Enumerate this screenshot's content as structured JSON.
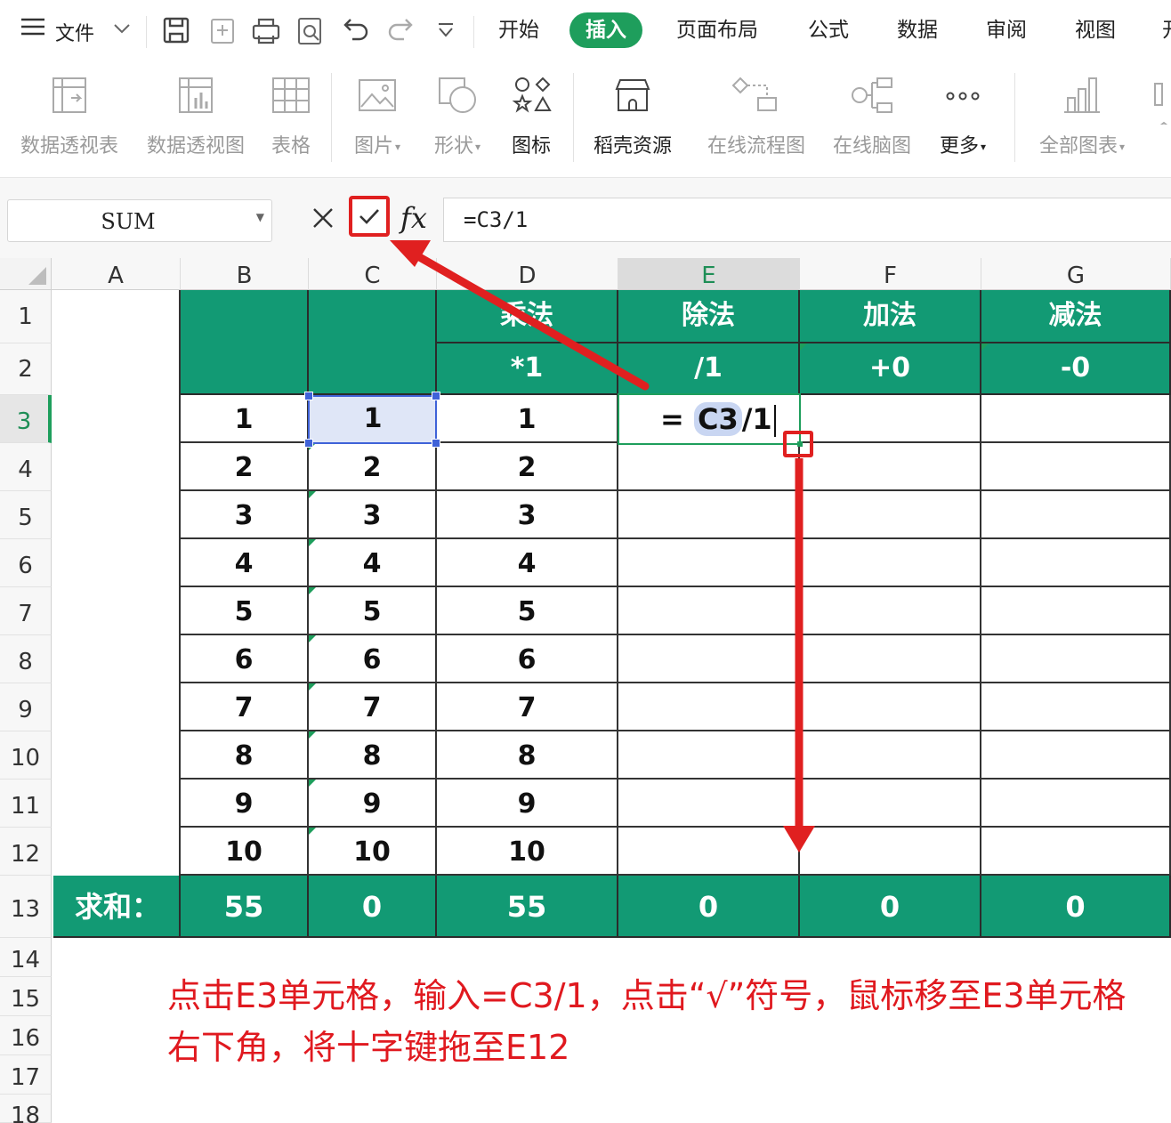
{
  "menu": {
    "file_label": "文件",
    "tabs": [
      "开始",
      "插入",
      "页面布局",
      "公式",
      "数据",
      "审阅",
      "视图"
    ],
    "active_tab": "插入",
    "cutoff_tab": "开"
  },
  "ribbon": {
    "items": [
      {
        "label": "数据透视表",
        "icon": "pivot-table-icon",
        "dark": false,
        "caret": false
      },
      {
        "label": "数据透视图",
        "icon": "pivot-chart-icon",
        "dark": false,
        "caret": false
      },
      {
        "label": "表格",
        "icon": "table-icon",
        "dark": false,
        "caret": false
      },
      {
        "label": "图片",
        "icon": "picture-icon",
        "dark": false,
        "caret": true
      },
      {
        "label": "形状",
        "icon": "shape-icon",
        "dark": false,
        "caret": true
      },
      {
        "label": "图标",
        "icon": "icons-icon",
        "dark": true,
        "caret": false
      },
      {
        "label": "稻壳资源",
        "icon": "docer-resource-icon",
        "dark": true,
        "caret": false
      },
      {
        "label": "在线流程图",
        "icon": "flowchart-icon",
        "dark": false,
        "caret": false
      },
      {
        "label": "在线脑图",
        "icon": "mindmap-icon",
        "dark": false,
        "caret": false
      },
      {
        "label": "更多",
        "icon": "more-icon",
        "dark": true,
        "caret": true
      },
      {
        "label": "全部图表",
        "icon": "all-charts-icon",
        "dark": false,
        "caret": true
      }
    ]
  },
  "formula_bar": {
    "name_box": "SUM",
    "formula": "=C3/1"
  },
  "sheet": {
    "columns": [
      "A",
      "B",
      "C",
      "D",
      "E",
      "F",
      "G"
    ],
    "selected_column": "E",
    "rows": [
      "1",
      "2",
      "3",
      "4",
      "5",
      "6",
      "7",
      "8",
      "9",
      "10",
      "11",
      "12",
      "13",
      "14",
      "15",
      "16",
      "17",
      "18"
    ],
    "selected_row": "3",
    "header_row1": [
      "乘法",
      "除法",
      "加法",
      "减法"
    ],
    "header_row2": [
      "*1",
      "/1",
      "+0",
      "-0"
    ],
    "col_b": [
      "1",
      "2",
      "3",
      "4",
      "5",
      "6",
      "7",
      "8",
      "9",
      "10"
    ],
    "col_c": [
      "1",
      "2",
      "3",
      "4",
      "5",
      "6",
      "7",
      "8",
      "9",
      "10"
    ],
    "col_d": [
      "1",
      "2",
      "3",
      "4",
      "5",
      "6",
      "7",
      "8",
      "9",
      "10"
    ],
    "editing_cell": {
      "eq": "=",
      "ref": "C3",
      "rest": "/1"
    },
    "totals_label": "求和：",
    "totals": [
      "55",
      "0",
      "55",
      "0",
      "0",
      "0"
    ]
  },
  "annotation": {
    "text": "点击E3单元格，输入=C3/1，点击“√”符号，鼠标移至E3单元格右下角，将十字键拖至E12",
    "color": "#e0191f"
  },
  "colors": {
    "accent": "#1e9e5c",
    "header_fill": "#129a74",
    "highlight_red": "#e02020",
    "selection_blue": "#3f62d8"
  }
}
